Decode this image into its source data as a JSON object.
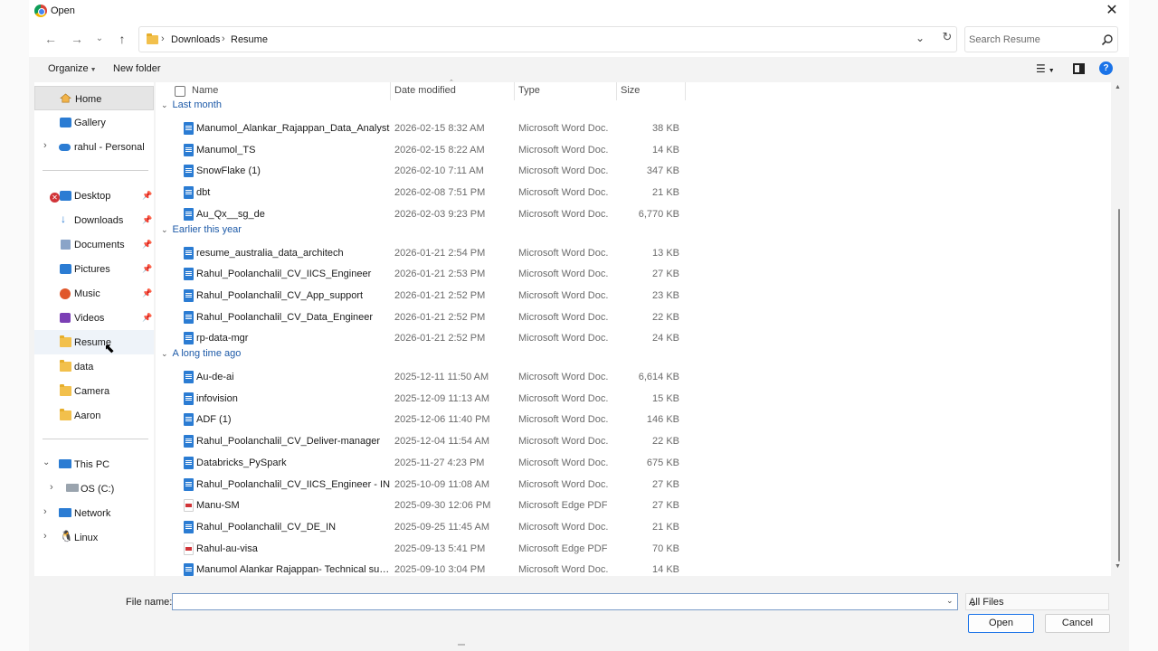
{
  "window": {
    "title": "Open"
  },
  "address": {
    "crumbs": [
      "Downloads",
      "Resume"
    ]
  },
  "search": {
    "placeholder": "Search Resume"
  },
  "toolbar": {
    "organize_label": "Organize",
    "new_folder_label": "New folder"
  },
  "sidebar": {
    "top": [
      {
        "label": "Home",
        "icon": "home-icon"
      },
      {
        "label": "Gallery",
        "icon": "gallery-icon"
      },
      {
        "label": "rahul - Personal",
        "icon": "onedrive-icon"
      }
    ],
    "quick": [
      {
        "label": "Desktop",
        "icon": "desktop-icon"
      },
      {
        "label": "Downloads",
        "icon": "download-icon"
      },
      {
        "label": "Documents",
        "icon": "documents-icon"
      },
      {
        "label": "Pictures",
        "icon": "pictures-icon"
      },
      {
        "label": "Music",
        "icon": "music-icon"
      },
      {
        "label": "Videos",
        "icon": "videos-icon"
      },
      {
        "label": "Resume",
        "icon": "folder-icon"
      },
      {
        "label": "data",
        "icon": "folder-icon"
      },
      {
        "label": "Camera",
        "icon": "folder-icon"
      },
      {
        "label": "Aaron",
        "icon": "folder-icon"
      }
    ],
    "bottom": [
      {
        "label": "This PC",
        "icon": "pc-icon"
      },
      {
        "label": "OS (C:)",
        "icon": "drive-icon"
      },
      {
        "label": "Network",
        "icon": "network-icon"
      },
      {
        "label": "Linux",
        "icon": "linux-icon"
      }
    ]
  },
  "columns": {
    "name": "Name",
    "date": "Date modified",
    "type": "Type",
    "size": "Size"
  },
  "groups": [
    {
      "label": "Last month",
      "files": [
        {
          "name": "Manumol_Alankar_Rajappan_Data_Analyst",
          "date": "2026-02-15 8:32 AM",
          "type": "Microsoft Word Doc...",
          "size": "38 KB",
          "kind": "word"
        },
        {
          "name": "Manumol_TS",
          "date": "2026-02-15 8:22 AM",
          "type": "Microsoft Word Doc...",
          "size": "14 KB",
          "kind": "word"
        },
        {
          "name": "SnowFlake (1)",
          "date": "2026-02-10 7:11 AM",
          "type": "Microsoft Word Doc...",
          "size": "347 KB",
          "kind": "word"
        },
        {
          "name": "dbt",
          "date": "2026-02-08 7:51 PM",
          "type": "Microsoft Word Doc...",
          "size": "21 KB",
          "kind": "word"
        },
        {
          "name": "Au_Qx__sg_de",
          "date": "2026-02-03 9:23 PM",
          "type": "Microsoft Word Doc...",
          "size": "6,770 KB",
          "kind": "word"
        }
      ]
    },
    {
      "label": "Earlier this year",
      "files": [
        {
          "name": "resume_australia_data_architech",
          "date": "2026-01-21 2:54 PM",
          "type": "Microsoft Word Doc...",
          "size": "13 KB",
          "kind": "word"
        },
        {
          "name": "Rahul_Poolanchalil_CV_IICS_Engineer",
          "date": "2026-01-21 2:53 PM",
          "type": "Microsoft Word Doc...",
          "size": "27 KB",
          "kind": "word"
        },
        {
          "name": "Rahul_Poolanchalil_CV_App_support",
          "date": "2026-01-21 2:52 PM",
          "type": "Microsoft Word Doc...",
          "size": "23 KB",
          "kind": "word"
        },
        {
          "name": "Rahul_Poolanchalil_CV_Data_Engineer",
          "date": "2026-01-21 2:52 PM",
          "type": "Microsoft Word Doc...",
          "size": "22 KB",
          "kind": "word"
        },
        {
          "name": "rp-data-mgr",
          "date": "2026-01-21 2:52 PM",
          "type": "Microsoft Word Doc...",
          "size": "24 KB",
          "kind": "word"
        }
      ]
    },
    {
      "label": "A long time ago",
      "files": [
        {
          "name": "Au-de-ai",
          "date": "2025-12-11 11:50 AM",
          "type": "Microsoft Word Doc...",
          "size": "6,614 KB",
          "kind": "word"
        },
        {
          "name": "infovision",
          "date": "2025-12-09 11:13 AM",
          "type": "Microsoft Word Doc...",
          "size": "15 KB",
          "kind": "word"
        },
        {
          "name": "ADF (1)",
          "date": "2025-12-06 11:40 PM",
          "type": "Microsoft Word Doc...",
          "size": "146 KB",
          "kind": "word"
        },
        {
          "name": "Rahul_Poolanchalil_CV_Deliver-manager",
          "date": "2025-12-04 11:54 AM",
          "type": "Microsoft Word Doc...",
          "size": "22 KB",
          "kind": "word"
        },
        {
          "name": "Databricks_PySpark",
          "date": "2025-11-27 4:23 PM",
          "type": "Microsoft Word Doc...",
          "size": "675 KB",
          "kind": "word"
        },
        {
          "name": "Rahul_Poolanchalil_CV_IICS_Engineer - IN",
          "date": "2025-10-09 11:08 AM",
          "type": "Microsoft Word Doc...",
          "size": "27 KB",
          "kind": "word"
        },
        {
          "name": "Manu-SM",
          "date": "2025-09-30 12:06 PM",
          "type": "Microsoft Edge PDF ...",
          "size": "27 KB",
          "kind": "pdf"
        },
        {
          "name": "Rahul_Poolanchalil_CV_DE_IN",
          "date": "2025-09-25 11:45 AM",
          "type": "Microsoft Word Doc...",
          "size": "21 KB",
          "kind": "word"
        },
        {
          "name": "Rahul-au-visa",
          "date": "2025-09-13 5:41 PM",
          "type": "Microsoft Edge PDF ...",
          "size": "70 KB",
          "kind": "pdf"
        },
        {
          "name": "Manumol Alankar Rajappan- Technical supp...",
          "date": "2025-09-10 3:04 PM",
          "type": "Microsoft Word Doc...",
          "size": "14 KB",
          "kind": "word"
        }
      ]
    }
  ],
  "footer": {
    "file_name_label": "File name:",
    "file_name_value": "",
    "filter_value": "All Files",
    "open_label": "Open",
    "cancel_label": "Cancel"
  },
  "colors": {
    "accent": "#1a73e8",
    "word": "#2b7cd3",
    "group": "#1d5aa8",
    "folder": "#f2c04c"
  }
}
